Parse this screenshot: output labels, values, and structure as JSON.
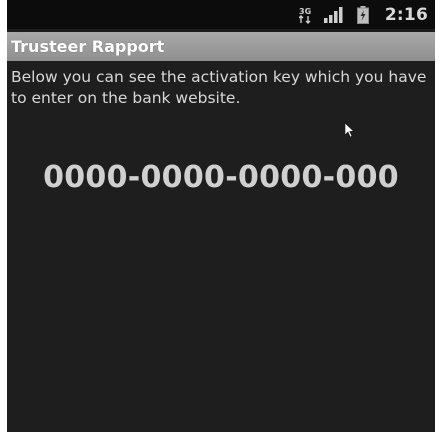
{
  "status_bar": {
    "time": "2:16",
    "icons": [
      "data-connection-icon",
      "signal-strength-icon",
      "battery-charging-icon"
    ]
  },
  "app": {
    "title": "Trusteer Rapport"
  },
  "content": {
    "instructions": "Below you can see the activation key which you have to enter on the bank website.",
    "activation_key": "0000-0000-0000-000"
  },
  "colors": {
    "background": "#1f1e1e",
    "title_bar": "#9e9e9e",
    "text": "#d8d8d8"
  }
}
